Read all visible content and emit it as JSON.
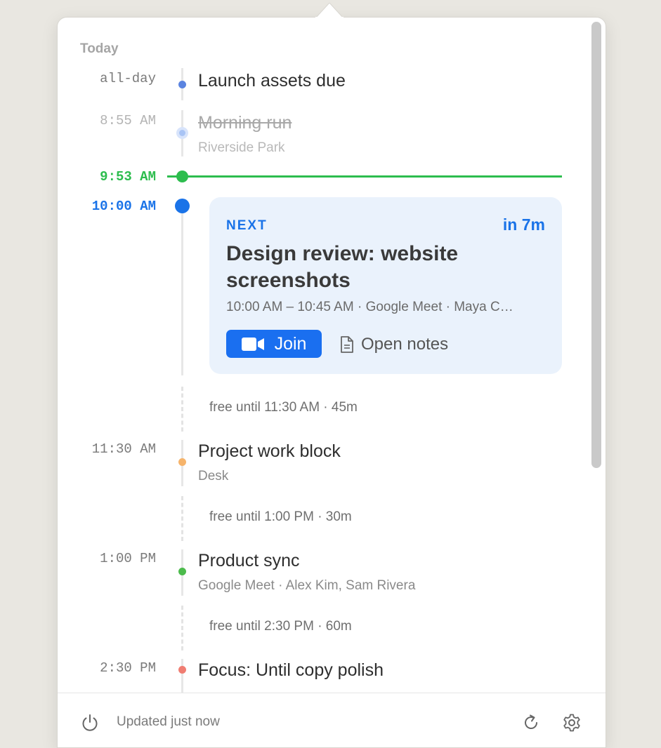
{
  "header": {
    "section_label": "Today"
  },
  "colors": {
    "now": "#2dbd4e",
    "next": "#1a73e8",
    "join_button": "#1a6ff0",
    "card_background": "#eaf2fc"
  },
  "events": [
    {
      "time": "all-day",
      "title": "Launch assets due",
      "subtitle": "",
      "dot_color": "#5b84e0",
      "state": "upcoming"
    },
    {
      "time": "8:55 AM",
      "title": "Morning run",
      "subtitle": "Riverside Park",
      "dot_color": "#a9c4f5",
      "state": "done"
    },
    {
      "time": "11:30 AM",
      "title": "Project work block",
      "subtitle": "Desk",
      "dot_color": "#f6b46b",
      "state": "upcoming"
    },
    {
      "time": "1:00 PM",
      "title": "Product sync",
      "subtitle": "Google Meet · Alex Kim, Sam Rivera",
      "dot_color": "#4cbb4c",
      "state": "upcoming"
    },
    {
      "time": "2:30 PM",
      "title": "Focus: Until copy polish",
      "subtitle": "",
      "dot_color": "#f07d72",
      "state": "upcoming"
    }
  ],
  "now_marker": {
    "time": "9:53 AM"
  },
  "next_event": {
    "time": "10:00 AM",
    "label": "NEXT",
    "eta": "in 7m",
    "title": "Design review: website screenshots",
    "meta": "10:00 AM – 10:45 AM · Google Meet · Maya C…",
    "join_label": "Join",
    "notes_label": "Open notes",
    "join_icon": "video-camera-icon",
    "notes_icon": "document-icon"
  },
  "free_slots": [
    {
      "text": "free until 11:30 AM · 45m"
    },
    {
      "text": "free until 1:00 PM · 30m"
    },
    {
      "text": "free until 2:30 PM · 60m"
    }
  ],
  "footer": {
    "status": "Updated just now",
    "power_icon": "power-icon",
    "refresh_icon": "refresh-icon",
    "settings_icon": "gear-icon"
  }
}
